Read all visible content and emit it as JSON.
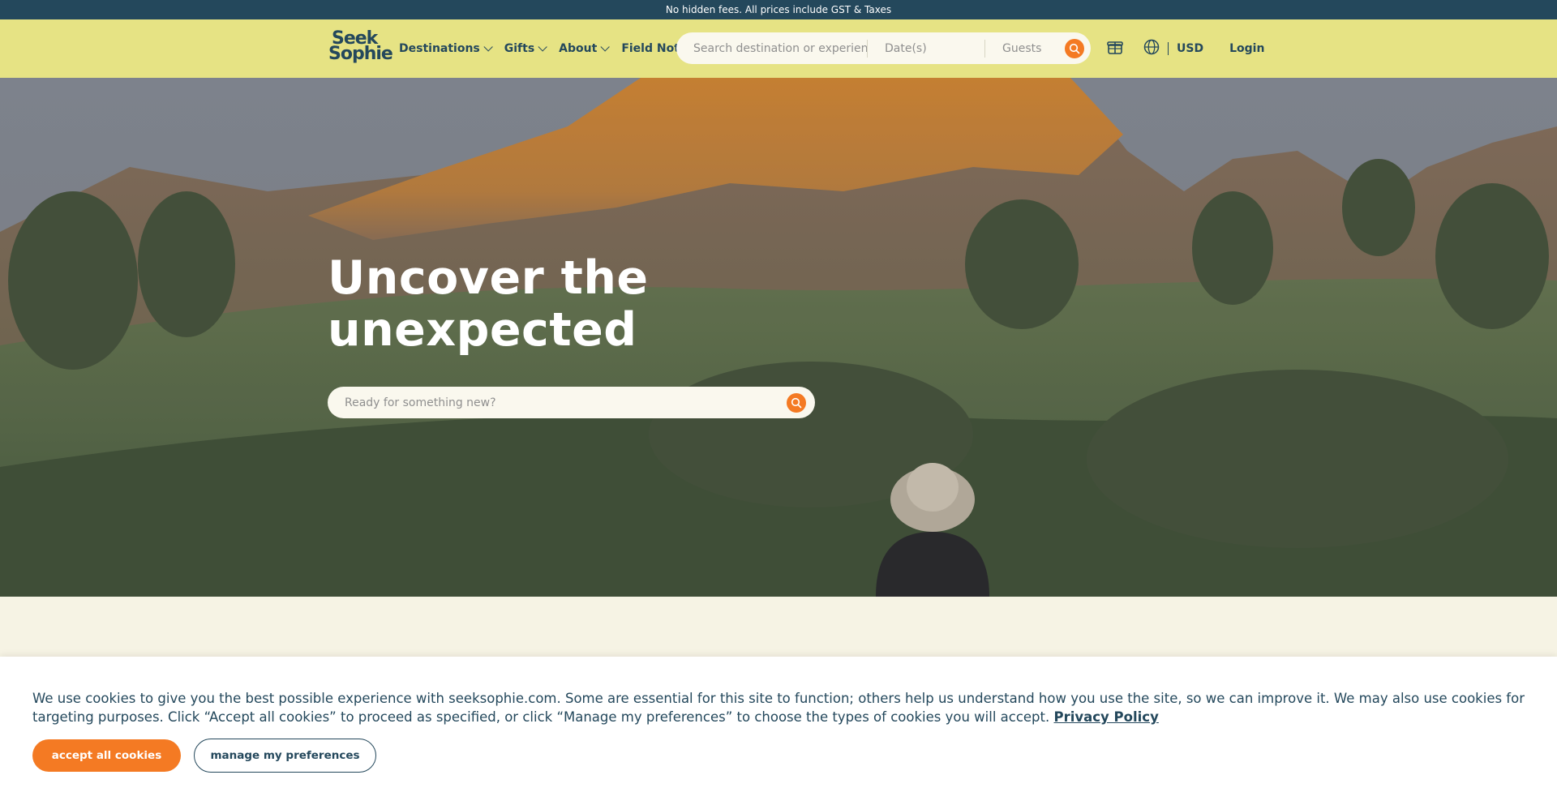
{
  "announcement": "No hidden fees. All prices include GST & Taxes",
  "logo": {
    "line1": "Seek",
    "line2": "Sophie"
  },
  "nav": [
    {
      "label": "Destinations",
      "dropdown": true
    },
    {
      "label": "Gifts",
      "dropdown": true
    },
    {
      "label": "About",
      "dropdown": true
    },
    {
      "label": "Field Notes",
      "dropdown": false
    }
  ],
  "search": {
    "destination_placeholder": "Search destination or experiences",
    "dates_placeholder": "Date(s)",
    "guests_placeholder": "Guests"
  },
  "header_right": {
    "currency": "USD",
    "login": "Login"
  },
  "hero": {
    "title_line1": "Uncover the",
    "title_line2": "unexpected",
    "search_placeholder": "Ready for something new?"
  },
  "cookie": {
    "text": "We use cookies to give you the best possible experience with seeksophie.com. Some are essential for this site to function; others help us understand how you use the site, so we can improve it. We may also use cookies for targeting purposes. Click “Accept all cookies” to proceed as specified, or click “Manage my preferences” to choose the types of cookies you will accept.",
    "link": "Privacy Policy",
    "accept_label": "accept all cookies",
    "manage_label": "manage my preferences"
  },
  "colors": {
    "announcement_bg": "#24485c",
    "header_bg": "#e6e384",
    "accent": "#f47a23",
    "text_dark": "#24485c",
    "page_bg": "#f6f3e4"
  },
  "icons": [
    "chevron-down-icon",
    "search-icon",
    "gift-box-icon",
    "globe-icon"
  ]
}
